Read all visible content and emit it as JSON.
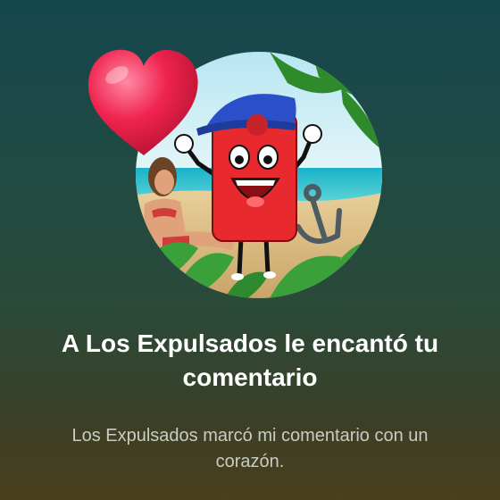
{
  "notification": {
    "title": "A Los Expulsados le encantó tu comentario",
    "body": "Los Expulsados marcó mi comentario con un corazón."
  },
  "icons": {
    "reaction": "heart-icon",
    "profile": "channel-avatar"
  },
  "colors": {
    "background_top": "#15474e",
    "background_bottom": "#4a3f1e",
    "title_text": "#ffffff",
    "body_text": "#c9ccc4",
    "heart": "#f0244f"
  }
}
